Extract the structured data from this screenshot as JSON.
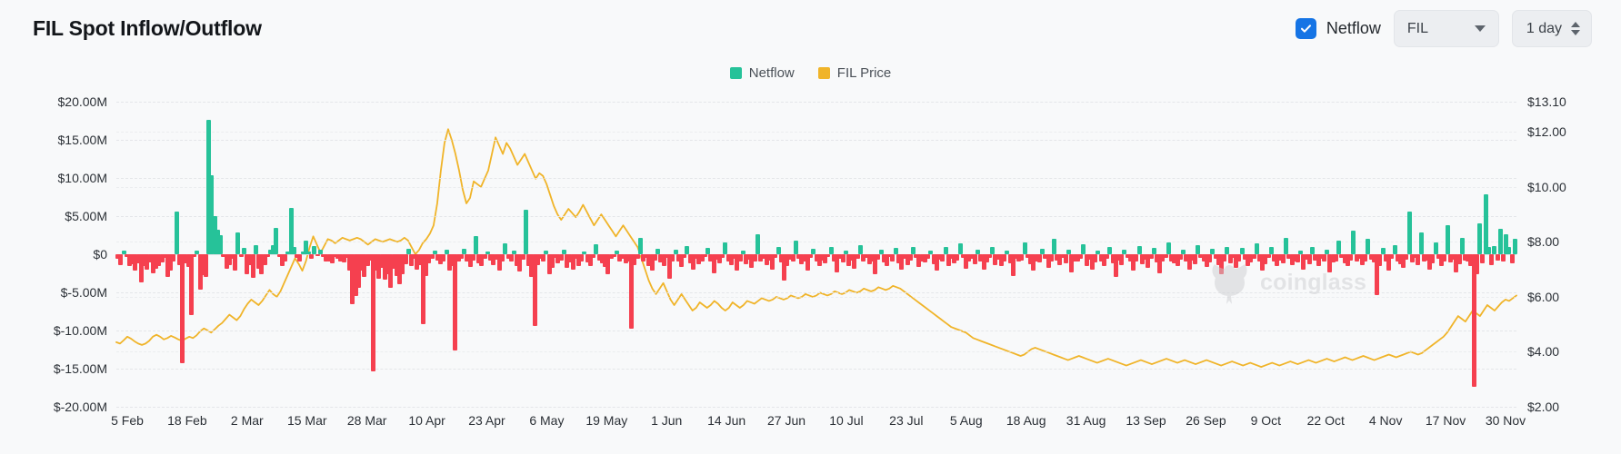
{
  "header": {
    "title": "FIL Spot Inflow/Outflow",
    "netflow_checkbox_label": "Netflow",
    "netflow_checked": true,
    "asset_select_value": "FIL",
    "period_select_value": "1 day",
    "checkbox_color": "#1574e5"
  },
  "watermark": {
    "text": "coinglass"
  },
  "chart_data": {
    "type": "bar",
    "title": "FIL Spot Inflow/Outflow",
    "xlabel": "",
    "ylabel": "",
    "grid": true,
    "legend_position": "top-center",
    "legend": [
      {
        "name": "Netflow",
        "color": "#26c299"
      },
      {
        "name": "FIL Price",
        "color": "#f0b429"
      }
    ],
    "y_left": {
      "label": "Netflow (USD)",
      "ticks": [
        "$20.00M",
        "$15.00M",
        "$10.00M",
        "$5.00M",
        "$0",
        "$-5.00M",
        "$-10.00M",
        "$-15.00M",
        "$-20.00M"
      ],
      "tick_values": [
        20000000,
        15000000,
        10000000,
        5000000,
        0,
        -5000000,
        -10000000,
        -15000000,
        -20000000
      ],
      "ylim": [
        -20000000,
        20000000
      ]
    },
    "y_right": {
      "label": "FIL Price (USD)",
      "ticks": [
        "$13.10",
        "$12.00",
        "$10.00",
        "$8.00",
        "$6.00",
        "$4.00",
        "$2.00"
      ],
      "tick_values": [
        13.1,
        12.0,
        10.0,
        8.0,
        6.0,
        4.0,
        2.0
      ],
      "ylim": [
        2.0,
        13.1
      ]
    },
    "x_ticks": [
      "5 Feb",
      "18 Feb",
      "2 Mar",
      "15 Mar",
      "28 Mar",
      "10 Apr",
      "23 Apr",
      "6 May",
      "19 May",
      "1 Jun",
      "14 Jun",
      "27 Jun",
      "10 Jul",
      "23 Jul",
      "5 Aug",
      "18 Aug",
      "31 Aug",
      "13 Sep",
      "26 Sep",
      "9 Oct",
      "22 Oct",
      "4 Nov",
      "17 Nov",
      "30 Nov"
    ],
    "positive_color": "#26c299",
    "negative_color": "#f5404f",
    "line_color": "#f0b429",
    "series": [
      {
        "name": "Netflow",
        "type": "bar",
        "unit": "USD",
        "values": [
          -0.6,
          -1.4,
          0.5,
          -0.4,
          -1.6,
          -1.3,
          -2.2,
          -1.2,
          -3.7,
          -1.6,
          -2.0,
          -1.1,
          -2.5,
          -1.9,
          -1.6,
          -1.1,
          -0.5,
          -3.0,
          -2.2,
          -1.0,
          5.6,
          -1.4,
          -14.3,
          -1.2,
          -1.7,
          -8.0,
          -0.3,
          0.5,
          -4.7,
          -2.7,
          -3.0,
          17.6,
          10.3,
          5.0,
          3.2,
          2.5,
          -0.4,
          -1.9,
          -1.4,
          -0.6,
          -2.2,
          2.9,
          -0.3,
          0.8,
          -2.6,
          -1.4,
          -3.1,
          1.2,
          -1.9,
          -2.6,
          -1.4,
          -0.4,
          0.6,
          1.2,
          3.4,
          -0.3,
          -1.5,
          -1.0,
          0.4,
          6.1,
          1.0,
          -0.5,
          -1.0,
          0.3,
          1.8,
          0.3,
          -0.6,
          1.1,
          -0.2,
          0.6,
          -0.3,
          -0.9,
          -1.0,
          -1.2,
          -0.4,
          -0.6,
          -0.9,
          -1.1,
          -0.5,
          -2.1,
          -6.5,
          -5.5,
          -4.4,
          -2.1,
          -3.0,
          -1.5,
          -0.8,
          -15.4,
          -2.1,
          -3.2,
          -1.8,
          -3.3,
          -2.6,
          -4.4,
          -1.9,
          -2.8,
          -3.9,
          -2.6,
          -1.3,
          0.7,
          -1.5,
          -0.6,
          -2.0,
          -1.4,
          -9.2,
          -2.9,
          -1.2,
          -0.6,
          0.5,
          -0.8,
          -1.3,
          -0.9,
          0.6,
          -2.1,
          -1.6,
          -12.6,
          -1.0,
          -0.6,
          0.7,
          -1.0,
          -1.7,
          -0.8,
          2.4,
          -1.2,
          -1.6,
          -0.6,
          0.4,
          -0.8,
          -1.4,
          -0.7,
          -2.2,
          -1.0,
          1.4,
          -0.6,
          -1.0,
          0.5,
          -1.5,
          -2.3,
          -0.7,
          5.8,
          -1.5,
          -3.0,
          -9.4,
          -1.4,
          -0.6,
          -1.0,
          0.5,
          -2.6,
          -1.8,
          -0.5,
          -1.2,
          -0.8,
          0.6,
          -1.8,
          -1.1,
          -2.0,
          -0.6,
          -1.5,
          -0.9,
          0.4,
          -1.1,
          -1.6,
          -0.5,
          1.3,
          -0.8,
          -1.2,
          -1.7,
          -2.6,
          -0.6,
          -0.3,
          0.5,
          -1.0,
          -0.6,
          -1.2,
          -0.9,
          -9.8,
          -1.4,
          -0.6,
          2.2,
          -1.0,
          -0.5,
          -1.6,
          -2.1,
          -0.8,
          0.7,
          -1.1,
          -1.6,
          -0.5,
          -3.2,
          -1.0,
          0.6,
          -0.9,
          -1.7,
          -0.5,
          1.1,
          -1.2,
          -2.0,
          -0.6,
          -1.3,
          -0.9,
          -0.4,
          0.8,
          -1.0,
          -2.5,
          -0.7,
          -1.2,
          -0.5,
          1.6,
          -0.9,
          -1.4,
          -0.6,
          -2.2,
          -1.0,
          0.5,
          -1.3,
          -0.7,
          -1.8,
          -0.9,
          2.6,
          -1.0,
          -0.6,
          -1.4,
          -0.8,
          -2.0,
          -0.5,
          0.9,
          -1.1,
          -3.4,
          -1.5,
          -0.7,
          -1.0,
          1.8,
          -0.6,
          -1.3,
          -0.9,
          -2.1,
          -0.5,
          0.7,
          -1.0,
          -1.6,
          -0.8,
          -1.2,
          -0.4,
          1.0,
          -0.9,
          -2.4,
          -0.6,
          -1.1,
          0.5,
          -1.5,
          -0.8,
          -1.9,
          -0.6,
          1.2,
          -1.0,
          -0.5,
          -1.3,
          -0.9,
          -2.6,
          -0.7,
          0.6,
          -1.1,
          -1.5,
          -0.4,
          -0.9,
          0.8,
          -1.2,
          -2.0,
          -0.6,
          -1.4,
          -0.8,
          1.0,
          -0.5,
          -1.7,
          -0.9,
          -1.1,
          -0.6,
          0.5,
          -1.3,
          -2.2,
          -0.7,
          -1.0,
          0.9,
          -1.5,
          -0.6,
          -1.2,
          -0.8,
          1.4,
          -0.5,
          -1.9,
          -1.0,
          -0.6,
          -1.3,
          0.6,
          -0.9,
          -2.0,
          -1.1,
          -0.5,
          1.0,
          -1.4,
          -0.7,
          -1.6,
          -0.9,
          0.5,
          -1.2,
          -2.8,
          -0.6,
          -1.0,
          -0.8,
          1.6,
          -0.5,
          -1.3,
          -2.1,
          -0.9,
          -1.1,
          0.7,
          -0.6,
          -1.8,
          -1.0,
          2.0,
          -0.8,
          -1.4,
          -0.5,
          -1.2,
          0.6,
          -2.4,
          -0.9,
          -1.0,
          -0.6,
          1.3,
          -1.5,
          -0.7,
          -2.0,
          -1.1,
          0.5,
          -0.9,
          -1.6,
          -0.6,
          1.0,
          -1.2,
          -3.0,
          -0.8,
          -1.4,
          0.6,
          -0.5,
          -1.0,
          -2.2,
          -0.9,
          1.1,
          -1.3,
          -0.7,
          -1.8,
          -0.6,
          0.8,
          -1.1,
          -2.5,
          -1.0,
          -0.5,
          1.5,
          -0.9,
          -1.2,
          -1.6,
          -0.7,
          0.6,
          -1.0,
          -2.0,
          -0.8,
          -1.3,
          1.2,
          -0.5,
          -0.9,
          -1.7,
          -1.1,
          0.7,
          -0.6,
          -1.4,
          -2.6,
          -0.9,
          1.0,
          -1.2,
          -0.5,
          -1.8,
          -1.0,
          0.8,
          -0.7,
          -1.5,
          -1.1,
          -0.6,
          1.4,
          -0.9,
          -2.1,
          -1.3,
          -0.5,
          0.9,
          -1.0,
          -1.6,
          -0.8,
          -1.2,
          2.2,
          -0.6,
          -1.4,
          -0.9,
          -1.1,
          0.5,
          -2.0,
          -0.7,
          -1.3,
          1.0,
          -0.8,
          -1.5,
          -0.6,
          -1.0,
          0.6,
          -2.4,
          -1.1,
          -0.9,
          1.8,
          -0.5,
          -1.2,
          -1.6,
          -0.8,
          3.1,
          -1.0,
          -0.6,
          -1.4,
          -0.9,
          2.0,
          -0.7,
          -1.1,
          -5.3,
          -1.5,
          0.8,
          -1.0,
          -2.2,
          -0.6,
          1.2,
          -0.9,
          -1.3,
          -1.8,
          -0.7,
          5.6,
          -1.1,
          -0.5,
          -1.4,
          2.8,
          -1.0,
          -0.8,
          -2.0,
          -1.2,
          1.5,
          -0.6,
          -1.6,
          -0.9,
          3.8,
          -1.1,
          -0.7,
          -2.4,
          -1.3,
          2.2,
          -0.8,
          -1.0,
          -1.5,
          -17.4,
          -2.6,
          4.0,
          -1.2,
          7.9,
          0.9,
          -1.4,
          1.1,
          -0.8,
          3.3,
          -1.0,
          2.6,
          1.0,
          -1.2,
          2.0
        ]
      },
      {
        "name": "FIL Price",
        "type": "line",
        "unit": "USD",
        "values": [
          4.35,
          4.3,
          4.42,
          4.55,
          4.48,
          4.38,
          4.3,
          4.25,
          4.3,
          4.4,
          4.55,
          4.62,
          4.55,
          4.45,
          4.5,
          4.58,
          4.52,
          4.45,
          4.4,
          4.48,
          4.55,
          4.5,
          4.6,
          4.75,
          4.85,
          4.78,
          4.7,
          4.82,
          4.95,
          5.05,
          5.2,
          5.35,
          5.25,
          5.15,
          5.3,
          5.55,
          5.75,
          5.9,
          5.8,
          5.7,
          5.85,
          6.05,
          6.25,
          6.1,
          6.0,
          6.2,
          6.5,
          6.8,
          7.1,
          7.4,
          7.2,
          6.95,
          7.3,
          7.8,
          8.2,
          7.9,
          7.6,
          7.85,
          8.1,
          8.05,
          7.95,
          8.05,
          8.15,
          8.1,
          8.05,
          8.1,
          8.15,
          8.1,
          8.0,
          7.9,
          8.0,
          8.1,
          8.05,
          8.0,
          8.05,
          8.1,
          8.05,
          8.0,
          8.05,
          8.15,
          8.05,
          7.8,
          7.55,
          7.7,
          7.95,
          8.1,
          8.3,
          8.6,
          9.4,
          10.6,
          11.6,
          12.1,
          11.7,
          11.2,
          10.6,
          9.9,
          9.4,
          9.6,
          10.2,
          10.1,
          10.0,
          10.3,
          10.6,
          11.2,
          11.8,
          11.5,
          11.2,
          11.6,
          11.4,
          11.1,
          10.8,
          11.0,
          11.2,
          10.9,
          10.6,
          10.3,
          10.5,
          10.4,
          10.1,
          9.7,
          9.3,
          9.0,
          8.8,
          9.0,
          9.2,
          9.05,
          8.9,
          9.1,
          9.35,
          9.1,
          8.85,
          8.6,
          8.8,
          9.0,
          8.8,
          8.6,
          8.4,
          8.2,
          8.4,
          8.6,
          8.4,
          8.2,
          8.0,
          7.8,
          7.4,
          7.0,
          6.6,
          6.3,
          6.1,
          6.3,
          6.5,
          6.2,
          5.9,
          5.7,
          5.9,
          6.1,
          5.9,
          5.7,
          5.5,
          5.6,
          5.8,
          5.7,
          5.6,
          5.7,
          5.85,
          5.75,
          5.6,
          5.5,
          5.6,
          5.8,
          5.7,
          5.6,
          5.7,
          5.85,
          5.8,
          5.75,
          5.85,
          5.95,
          5.9,
          5.85,
          5.9,
          6.0,
          5.95,
          5.9,
          5.95,
          6.05,
          6.0,
          5.95,
          6.0,
          6.1,
          6.05,
          6.0,
          6.05,
          6.15,
          6.1,
          6.05,
          6.1,
          6.2,
          6.15,
          6.1,
          6.15,
          6.25,
          6.2,
          6.15,
          6.2,
          6.3,
          6.25,
          6.2,
          6.25,
          6.35,
          6.3,
          6.25,
          6.3,
          6.4,
          6.35,
          6.3,
          6.2,
          6.1,
          6.0,
          5.9,
          5.8,
          5.7,
          5.6,
          5.5,
          5.4,
          5.3,
          5.2,
          5.1,
          5.0,
          4.9,
          4.85,
          4.8,
          4.75,
          4.7,
          4.6,
          4.5,
          4.45,
          4.4,
          4.35,
          4.3,
          4.25,
          4.2,
          4.15,
          4.1,
          4.05,
          4.0,
          3.95,
          3.9,
          3.85,
          3.9,
          4.0,
          4.1,
          4.15,
          4.1,
          4.05,
          4.0,
          3.95,
          3.9,
          3.85,
          3.8,
          3.75,
          3.7,
          3.75,
          3.8,
          3.85,
          3.8,
          3.75,
          3.7,
          3.65,
          3.6,
          3.65,
          3.7,
          3.75,
          3.7,
          3.65,
          3.6,
          3.55,
          3.5,
          3.55,
          3.6,
          3.65,
          3.7,
          3.65,
          3.6,
          3.55,
          3.6,
          3.65,
          3.7,
          3.75,
          3.7,
          3.65,
          3.6,
          3.65,
          3.7,
          3.65,
          3.6,
          3.55,
          3.6,
          3.65,
          3.7,
          3.65,
          3.6,
          3.55,
          3.5,
          3.55,
          3.6,
          3.65,
          3.6,
          3.55,
          3.5,
          3.55,
          3.6,
          3.55,
          3.5,
          3.45,
          3.5,
          3.55,
          3.6,
          3.55,
          3.5,
          3.55,
          3.6,
          3.65,
          3.6,
          3.55,
          3.6,
          3.65,
          3.7,
          3.65,
          3.6,
          3.65,
          3.7,
          3.75,
          3.7,
          3.65,
          3.7,
          3.75,
          3.8,
          3.75,
          3.7,
          3.75,
          3.8,
          3.85,
          3.8,
          3.75,
          3.7,
          3.75,
          3.8,
          3.85,
          3.9,
          3.85,
          3.8,
          3.85,
          3.9,
          3.95,
          4.0,
          3.95,
          3.9,
          3.95,
          4.05,
          4.15,
          4.25,
          4.35,
          4.45,
          4.55,
          4.7,
          4.9,
          5.1,
          5.3,
          5.2,
          5.1,
          5.3,
          5.5,
          5.4,
          5.3,
          5.5,
          5.7,
          5.6,
          5.5,
          5.65,
          5.8,
          5.9,
          5.85,
          5.95,
          6.05
        ]
      }
    ]
  }
}
